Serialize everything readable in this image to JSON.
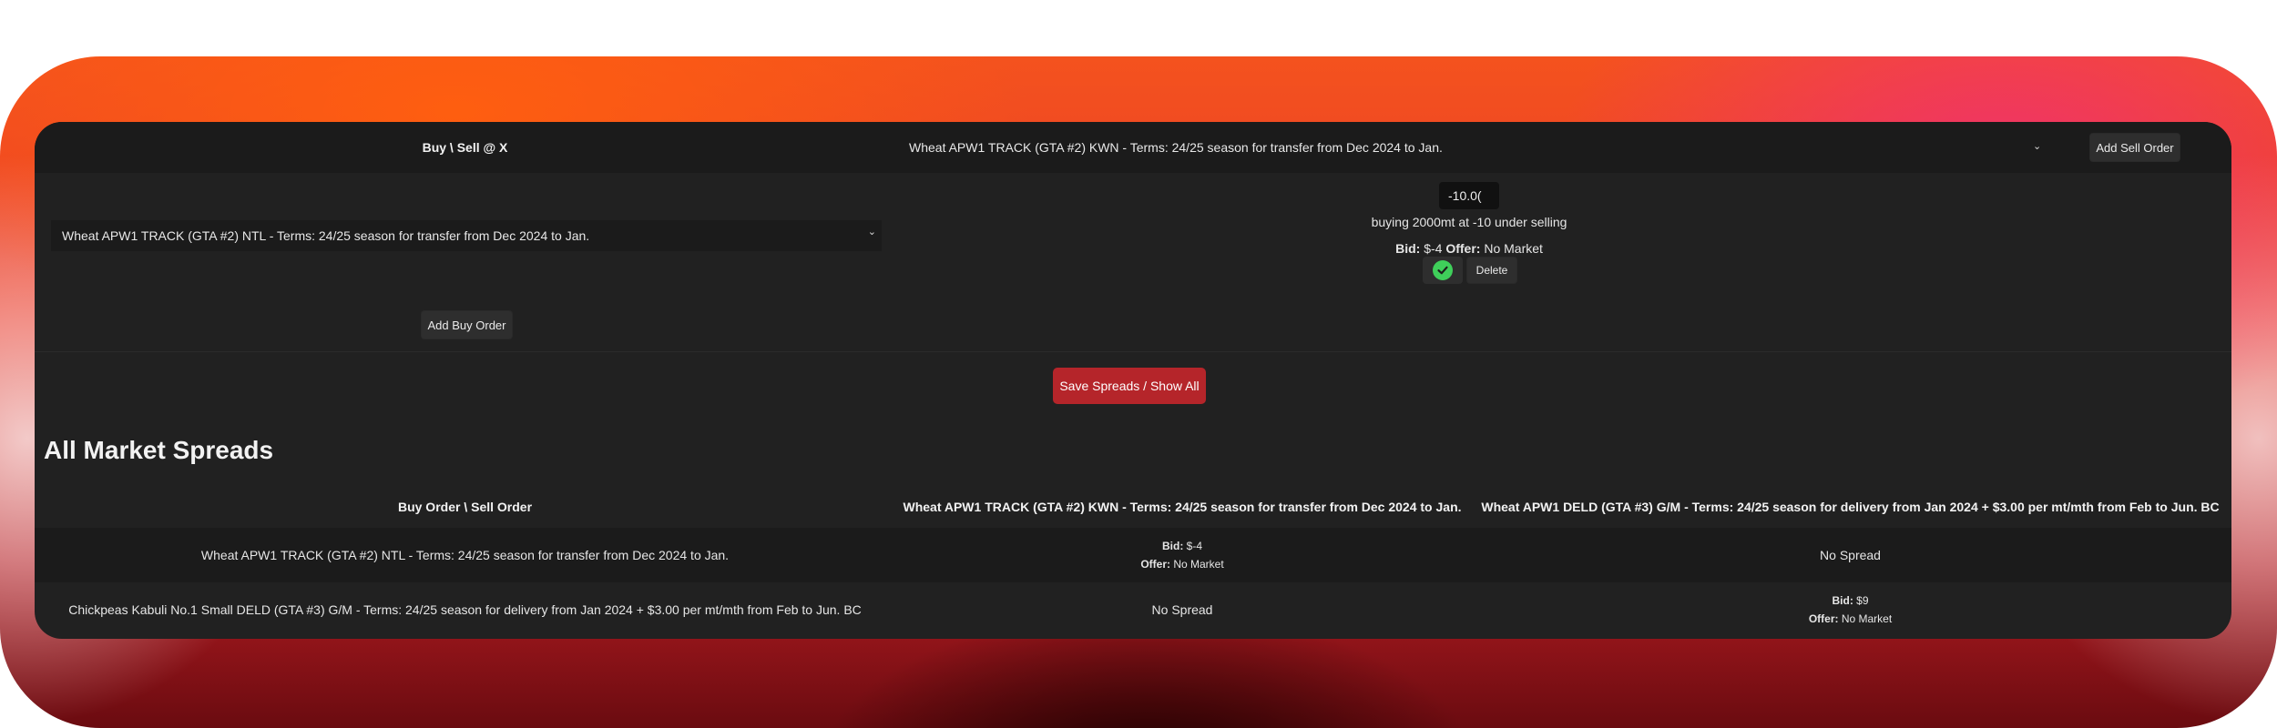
{
  "colors": {
    "panel": "#212121",
    "accent_red": "#b5252a",
    "check_green": "#3fcf5a"
  },
  "form": {
    "buy_sell_heading": "Buy \\ Sell @ X",
    "sell_select_value": "Wheat APW1 TRACK (GTA #2) KWN - Terms: 24/25 season for transfer from Dec 2024 to Jan.",
    "add_sell_label": "Add Sell Order",
    "buy_select_value": "Wheat APW1 TRACK (GTA #2) NTL - Terms: 24/25 season for transfer from Dec 2024 to Jan.",
    "add_buy_label": "Add Buy Order",
    "spread_value": "-10.0(",
    "description": "buying 2000mt at -10 under selling",
    "bid_label": "Bid:",
    "bid_value": "$-4",
    "offer_label": "Offer:",
    "offer_value": "No Market",
    "confirm_icon": "check-icon",
    "delete_label": "Delete",
    "save_label": "Save Spreads / Show All"
  },
  "spreads": {
    "title": "All Market Spreads",
    "headers": [
      "Buy Order \\ Sell Order",
      "Wheat APW1 TRACK (GTA #2) KWN - Terms: 24/25 season for transfer from Dec 2024 to Jan.",
      "Wheat APW1 DELD (GTA #3) G/M - Terms: 24/25 season for delivery from Jan 2024 + $3.00 per mt/mth from Feb to Jun. BC"
    ],
    "rows": [
      {
        "name": "Wheat APW1 TRACK (GTA #2) NTL - Terms: 24/25 season for transfer from Dec 2024 to Jan.",
        "c1": {
          "bid_label": "Bid:",
          "bid": "$-4",
          "offer_label": "Offer:",
          "offer": "No Market"
        },
        "c2": {
          "text": "No Spread"
        }
      },
      {
        "name": "Chickpeas Kabuli No.1 Small DELD (GTA #3) G/M - Terms: 24/25 season for delivery from Jan 2024 + $3.00 per mt/mth from Feb to Jun. BC",
        "c1": {
          "text": "No Spread"
        },
        "c2": {
          "bid_label": "Bid:",
          "bid": "$9",
          "offer_label": "Offer:",
          "offer": "No Market"
        }
      }
    ]
  }
}
